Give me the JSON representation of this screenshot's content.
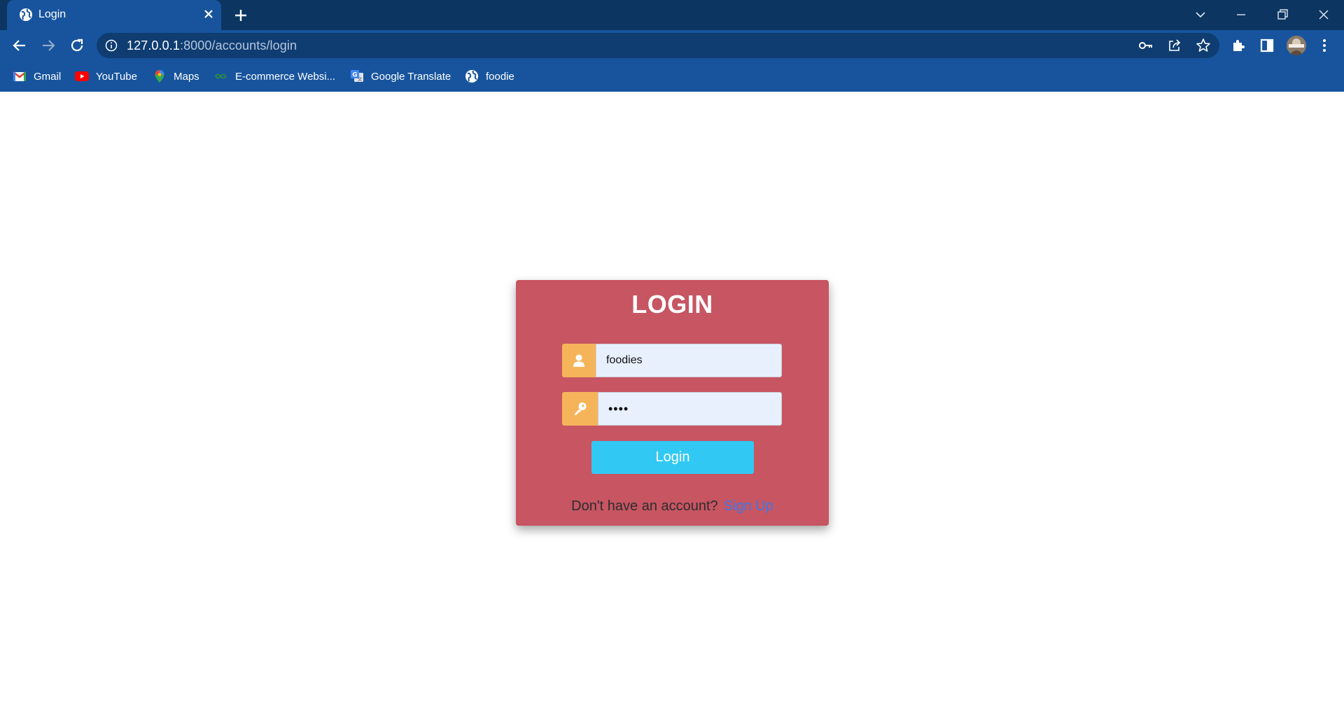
{
  "browser": {
    "tab": {
      "title": "Login"
    },
    "url": {
      "host": "127.0.0.1",
      "path": ":8000/accounts/login"
    },
    "bookmarks": [
      {
        "label": "Gmail",
        "icon": "gmail-icon"
      },
      {
        "label": "YouTube",
        "icon": "youtube-icon"
      },
      {
        "label": "Maps",
        "icon": "maps-icon"
      },
      {
        "label": "E-commerce Websi...",
        "icon": "ecommerce-icon"
      },
      {
        "label": "Google Translate",
        "icon": "translate-icon"
      },
      {
        "label": "foodie",
        "icon": "globe-icon"
      }
    ]
  },
  "login": {
    "title": "LOGIN",
    "username": {
      "value": "foodies",
      "icon": "user-icon"
    },
    "password": {
      "value": "••••",
      "icon": "key-icon"
    },
    "button_label": "Login",
    "signup_prompt": "Don't have an account?",
    "signup_link": "Sign Up"
  },
  "colors": {
    "card": "#c75562",
    "icon_box": "#f6b45a",
    "button": "#31c9f4",
    "link": "#3d78e8",
    "chrome": "#17549d"
  }
}
